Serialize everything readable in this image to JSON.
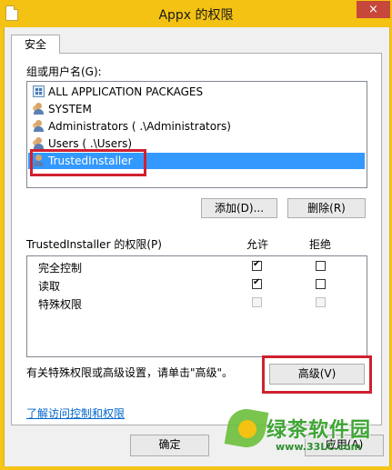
{
  "window": {
    "title": "Appx 的权限",
    "close_icon": "×"
  },
  "tabs": [
    {
      "label": "安全"
    }
  ],
  "groups": {
    "label": "组或用户名(G):",
    "items": [
      {
        "label": "ALL APPLICATION PACKAGES",
        "icon": "package-icon",
        "selected": false
      },
      {
        "label": "SYSTEM",
        "icon": "users-icon",
        "selected": false
      },
      {
        "label": "Administrators (        .\\Administrators)",
        "icon": "users-icon",
        "selected": false
      },
      {
        "label": "Users (        .\\Users)",
        "icon": "users-icon",
        "selected": false
      },
      {
        "label": "TrustedInstaller",
        "icon": "user-icon",
        "selected": true
      }
    ]
  },
  "buttons": {
    "add": "添加(D)...",
    "remove": "删除(R)",
    "advanced": "高级(V)",
    "ok": "确定",
    "apply": "应用(A)"
  },
  "permissions": {
    "label": "TrustedInstaller 的权限(P)",
    "allow_header": "允许",
    "deny_header": "拒绝",
    "rows": [
      {
        "name": "完全控制",
        "allow": "checked",
        "deny": "unchecked"
      },
      {
        "name": "读取",
        "allow": "checked",
        "deny": "unchecked"
      },
      {
        "name": "特殊权限",
        "allow": "disabled",
        "deny": "disabled"
      }
    ]
  },
  "special_note": "有关特殊权限或高级设置，请单击\"高级\"。",
  "help_link": "了解访问控制和权限",
  "watermark": {
    "name": "绿茶软件园",
    "url": "www.33LC.com"
  }
}
